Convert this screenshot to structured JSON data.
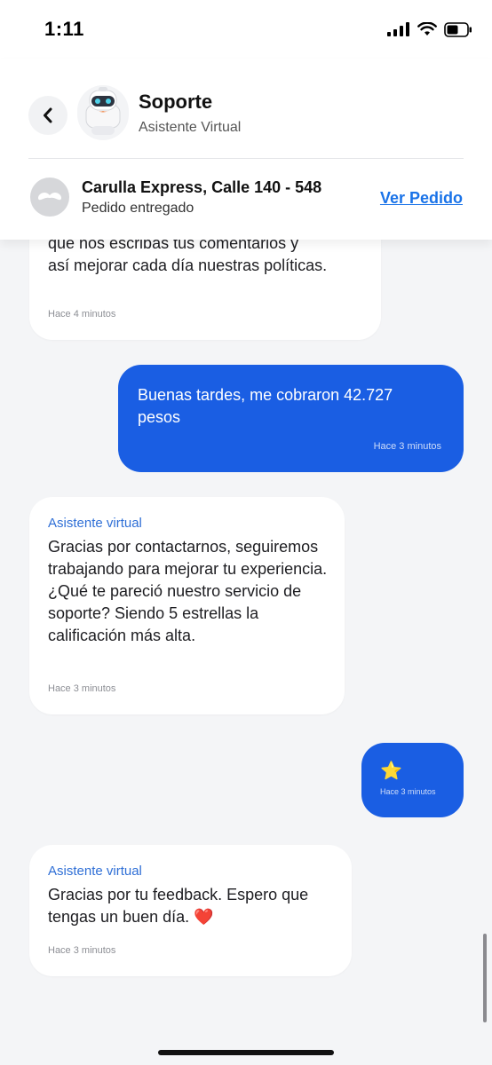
{
  "status_bar": {
    "time": "1:11"
  },
  "header": {
    "title": "Soporte",
    "subtitle": "Asistente Virtual",
    "store_name": "Carulla Express, Calle 140 - 548",
    "order_status": "Pedido entregado",
    "view_order": "Ver Pedido"
  },
  "messages": [
    {
      "direction": "incoming",
      "text_line_1": "que nos escribas tus comentarios y",
      "text_line_2": "así mejorar cada día nuestras políticas.",
      "time": "Hace 4 minutos"
    },
    {
      "direction": "outgoing",
      "text": "Buenas tardes, me cobraron 42.727 pesos",
      "time": "Hace 3 minutos"
    },
    {
      "direction": "incoming",
      "sender": "Asistente virtual",
      "text": "Gracias por contactarnos, seguiremos trabajando para mejorar tu experiencia. ¿Qué te pareció nuestro servicio de soporte? Siendo 5 estrellas la calificación más alta.",
      "time": "Hace 3 minutos"
    },
    {
      "direction": "outgoing",
      "text": "⭐",
      "time": "Hace 3 minutos"
    },
    {
      "direction": "incoming",
      "sender": "Asistente virtual",
      "text": "Gracias por tu feedback. Espero que tengas un buen día. ❤️",
      "time": "Hace 3 minutos"
    }
  ],
  "colors": {
    "accent": "#1a5ee3",
    "link": "#1a73e8",
    "sender": "#2f6fd6",
    "background": "#f4f5f7"
  },
  "icons": [
    "back-chevron-icon",
    "robot-avatar",
    "mustache-logo-icon",
    "signal-icon",
    "wifi-icon",
    "battery-icon"
  ]
}
